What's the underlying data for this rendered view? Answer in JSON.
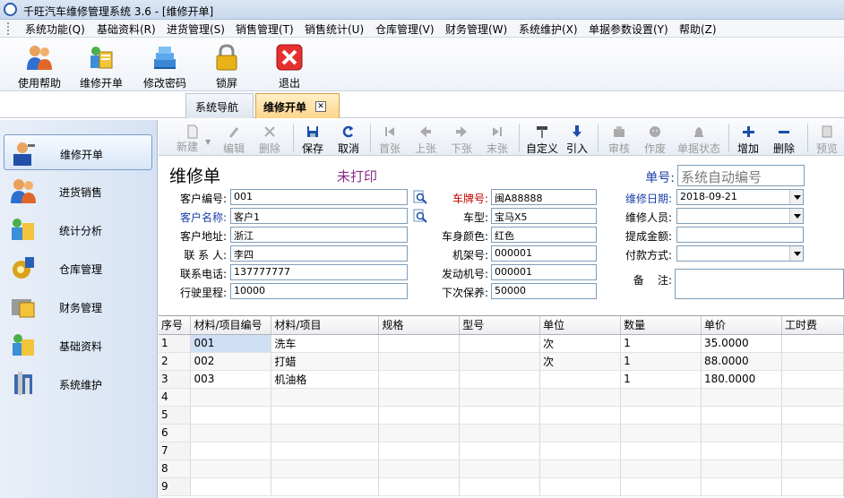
{
  "window": {
    "title": "千旺汽车维修管理系统 3.6 - [维修开单]"
  },
  "menu": [
    "系统功能(Q)",
    "基础资料(R)",
    "进货管理(S)",
    "销售管理(T)",
    "销售统计(U)",
    "仓库管理(V)",
    "财务管理(W)",
    "系统维护(X)",
    "单据参数设置(Y)",
    "帮助(Z)"
  ],
  "toolbar": [
    {
      "label": "使用帮助",
      "icon": "users-help-icon"
    },
    {
      "label": "维修开单",
      "icon": "repair-order-icon"
    },
    {
      "label": "修改密码",
      "icon": "change-password-icon"
    },
    {
      "label": "锁屏",
      "icon": "lock-icon"
    },
    {
      "label": "退出",
      "icon": "exit-icon"
    }
  ],
  "tabs": [
    {
      "label": "系统导航"
    },
    {
      "label": "维修开单",
      "close": "✕"
    }
  ],
  "nav": [
    {
      "label": "维修开单",
      "icon": "repair-worker-icon",
      "selected": true
    },
    {
      "label": "进货销售",
      "icon": "users-icon"
    },
    {
      "label": "统计分析",
      "icon": "analysis-icon"
    },
    {
      "label": "仓库管理",
      "icon": "warehouse-icon"
    },
    {
      "label": "财务管理",
      "icon": "finance-icon"
    },
    {
      "label": "基础资料",
      "icon": "basic-data-icon"
    },
    {
      "label": "系统维护",
      "icon": "maintenance-icon"
    }
  ],
  "subtoolbar": [
    {
      "label": "新建",
      "icon": "new-doc-icon",
      "enabled": false
    },
    {
      "label": "编辑",
      "icon": "pencil-icon",
      "enabled": false
    },
    {
      "label": "删除",
      "icon": "delete-x-icon",
      "enabled": false
    },
    {
      "label": "保存",
      "icon": "save-icon",
      "enabled": true
    },
    {
      "label": "取消",
      "icon": "cancel-icon",
      "enabled": true
    },
    {
      "label": "首张",
      "icon": "first-icon",
      "enabled": false
    },
    {
      "label": "上张",
      "icon": "prev-icon",
      "enabled": false
    },
    {
      "label": "下张",
      "icon": "next-icon",
      "enabled": false
    },
    {
      "label": "末张",
      "icon": "last-icon",
      "enabled": false
    },
    {
      "label": "自定义",
      "icon": "customize-icon",
      "enabled": true
    },
    {
      "label": "引入",
      "icon": "import-icon",
      "enabled": true
    },
    {
      "label": "审核",
      "icon": "audit-icon",
      "enabled": false
    },
    {
      "label": "作废",
      "icon": "void-icon",
      "enabled": false
    },
    {
      "label": "单据状态",
      "icon": "status-icon",
      "enabled": false
    },
    {
      "label": "增加",
      "icon": "add-icon",
      "enabled": true
    },
    {
      "label": "删除",
      "icon": "remove-icon",
      "enabled": true
    },
    {
      "label": "预览",
      "icon": "preview-icon",
      "enabled": false
    }
  ],
  "form": {
    "title": "维修单",
    "print_status": "未打印",
    "doc_no_label": "单号:",
    "doc_no_placeholder": "系统自动编号",
    "customer_no_label": "客户编号:",
    "customer_no": "001",
    "customer_name_label": "客户名称:",
    "customer_name": "客户1",
    "address_label": "客户地址:",
    "address": "浙江",
    "contact_label": "联 系 人:",
    "contact": "李四",
    "phone_label": "联系电话:",
    "phone": "137777777",
    "mileage_label": "行驶里程:",
    "mileage": "10000",
    "plate_label": "车牌号:",
    "plate": "闽A88888",
    "model_label": "车型:",
    "model": "宝马X5",
    "color_label": "车身颜色:",
    "color": "红色",
    "frame_label": "机架号:",
    "frame": "000001",
    "engine_label": "发动机号:",
    "engine": "000001",
    "next_service_label": "下次保养:",
    "next_service": "50000",
    "date_label": "维修日期:",
    "date": "2018-09-21",
    "staff_label": "维修人员:",
    "staff": "",
    "commission_label": "提成金额:",
    "commission": "",
    "payment_label": "付款方式:",
    "payment": "",
    "remark_label": "备    注:",
    "remark": ""
  },
  "grid": {
    "columns": [
      "序号",
      "材料/项目编号",
      "材料/项目",
      "规格",
      "型号",
      "单位",
      "数量",
      "单价",
      "工时费"
    ],
    "rows": [
      [
        "1",
        "001",
        "洗车",
        "",
        "",
        "次",
        "1",
        "35.0000",
        ""
      ],
      [
        "2",
        "002",
        "打蜡",
        "",
        "",
        "次",
        "1",
        "88.0000",
        ""
      ],
      [
        "3",
        "003",
        "机油格",
        "",
        "",
        "",
        "1",
        "180.0000",
        ""
      ],
      [
        "4",
        "",
        "",
        "",
        "",
        "",
        "",
        "",
        ""
      ],
      [
        "5",
        "",
        "",
        "",
        "",
        "",
        "",
        "",
        ""
      ],
      [
        "6",
        "",
        "",
        "",
        "",
        "",
        "",
        "",
        ""
      ],
      [
        "7",
        "",
        "",
        "",
        "",
        "",
        "",
        "",
        ""
      ],
      [
        "8",
        "",
        "",
        "",
        "",
        "",
        "",
        "",
        ""
      ],
      [
        "9",
        "",
        "",
        "",
        "",
        "",
        "",
        "",
        ""
      ]
    ]
  },
  "colors": {
    "accent_blue": "#1a3fa8",
    "required_red": "#c00000",
    "print_status": "#8a2b8a",
    "tab_active": "#ffd58a"
  }
}
